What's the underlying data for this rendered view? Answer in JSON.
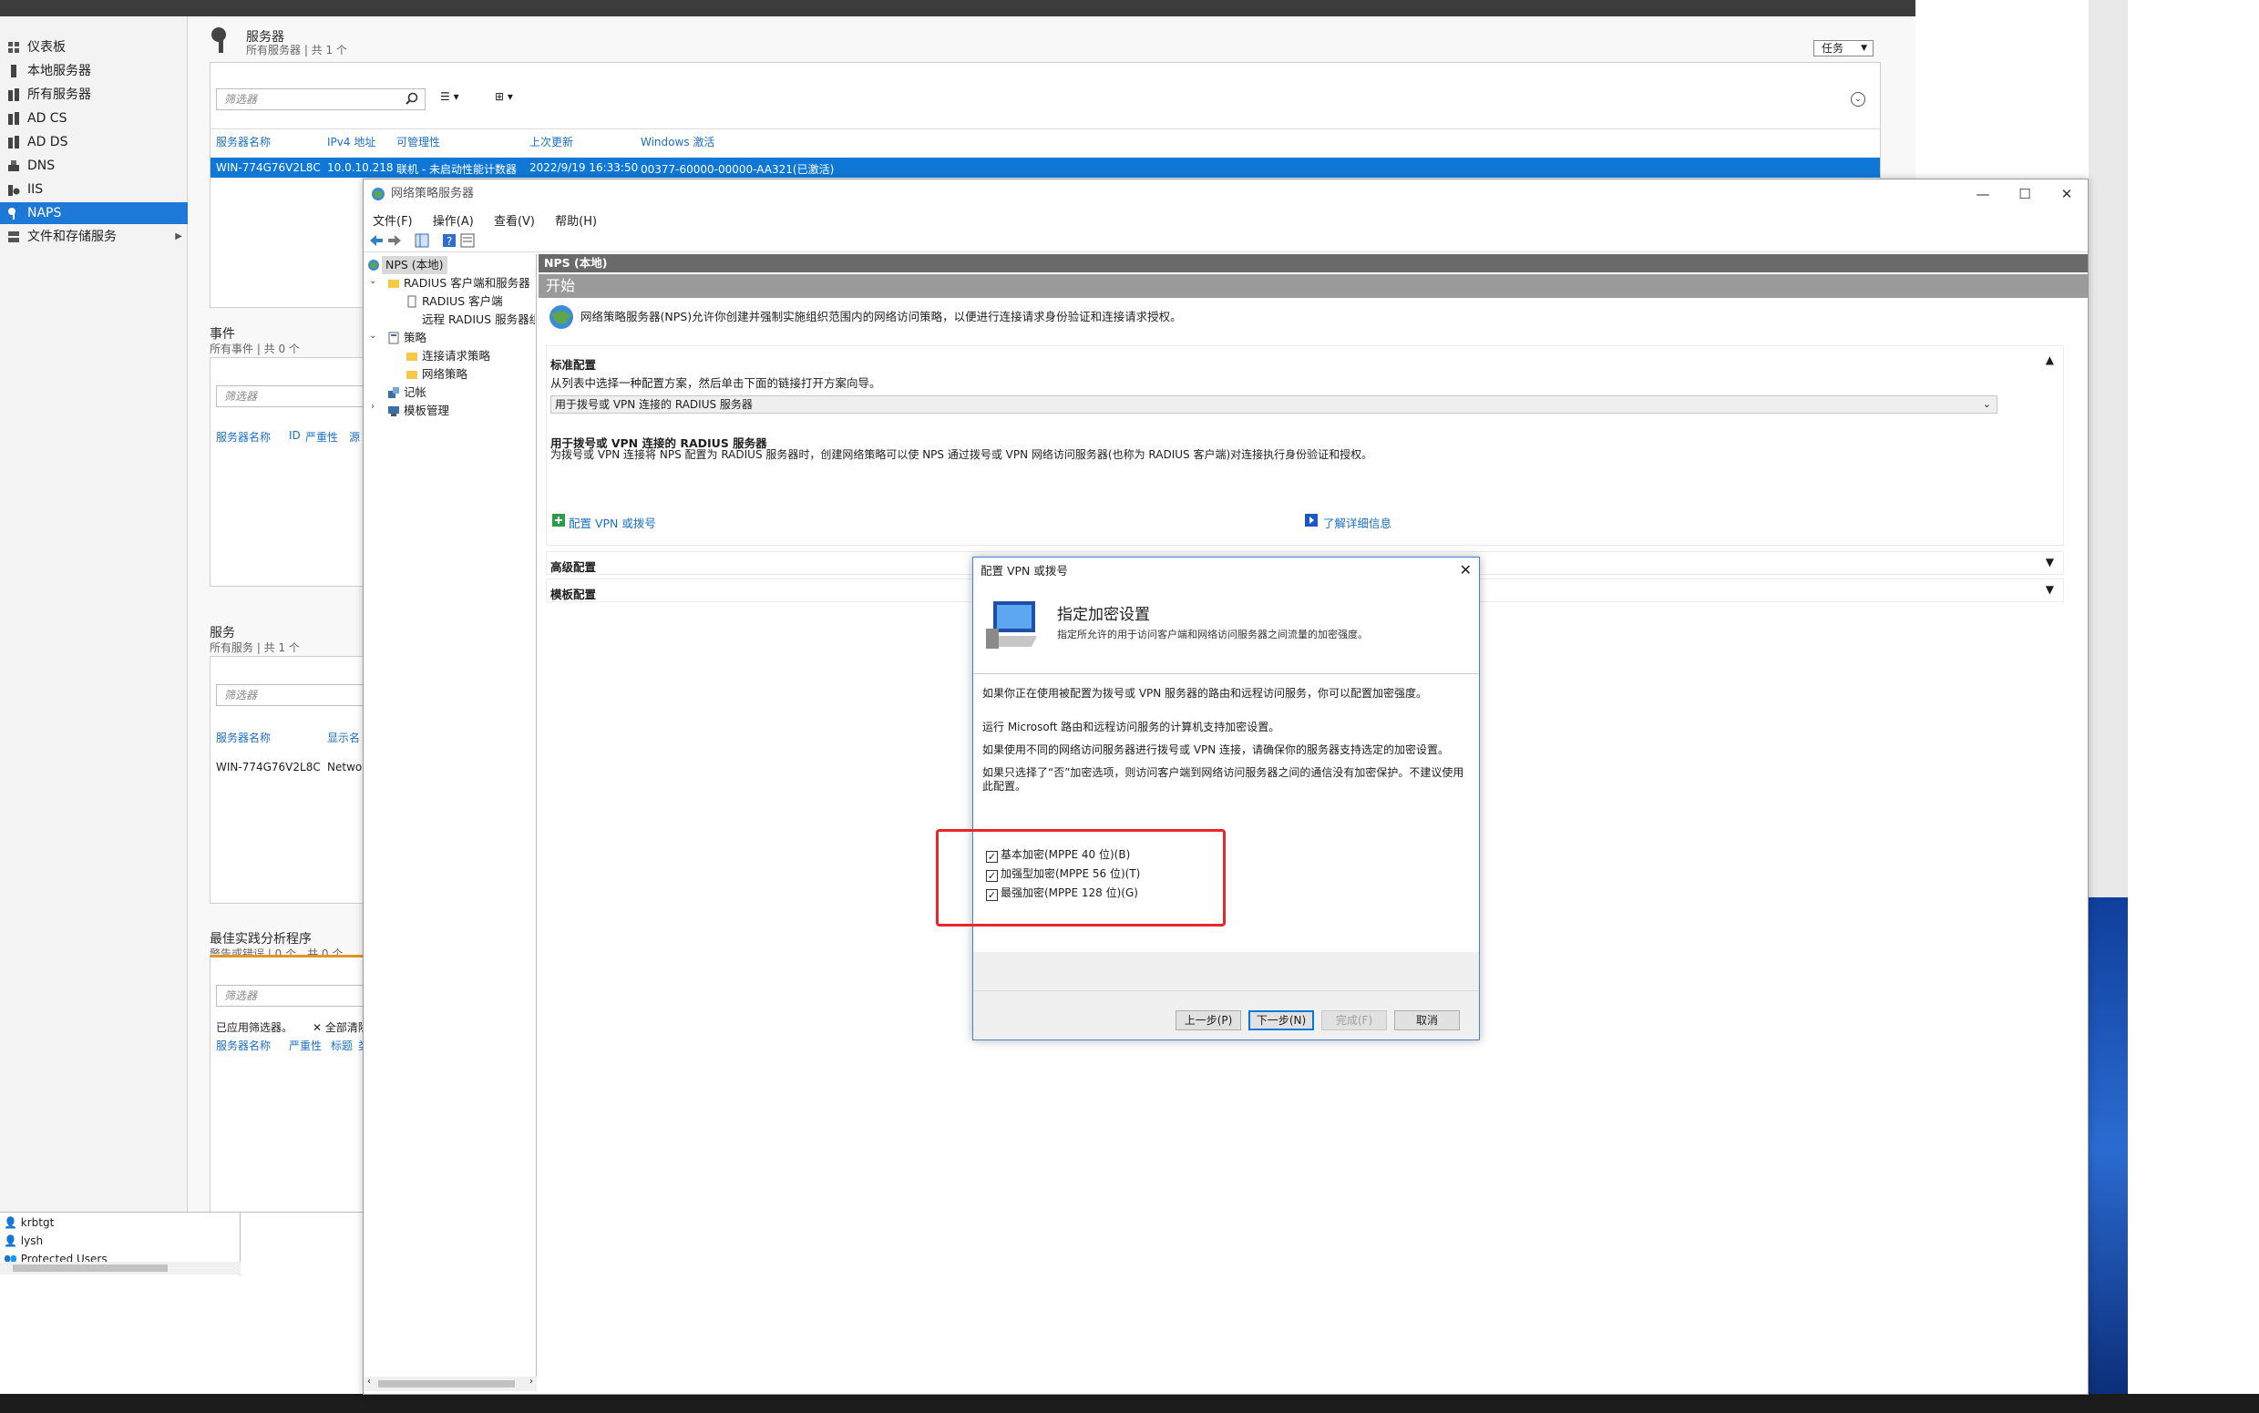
{
  "nav": {
    "items": [
      {
        "label": "仪表板",
        "icon": "dashboard-icon"
      },
      {
        "label": "本地服务器",
        "icon": "server-icon"
      },
      {
        "label": "所有服务器",
        "icon": "servers-icon"
      },
      {
        "label": "AD CS",
        "icon": "adcs-icon"
      },
      {
        "label": "AD DS",
        "icon": "adds-icon"
      },
      {
        "label": "DNS",
        "icon": "dns-icon"
      },
      {
        "label": "IIS",
        "icon": "iis-icon"
      },
      {
        "label": "NAPS",
        "icon": "naps-icon"
      },
      {
        "label": "文件和存储服务",
        "icon": "storage-icon"
      }
    ]
  },
  "servers": {
    "title": "服务器",
    "subtitle": "所有服务器 | 共 1 个",
    "filter_placeholder": "筛选器",
    "tasks_label": "任务",
    "columns": [
      "服务器名称",
      "IPv4 地址",
      "可管理性",
      "上次更新",
      "Windows 激活"
    ],
    "row": [
      "WIN-774G76V2L8C",
      "10.0.10.218",
      "联机 - 未启动性能计数器",
      "2022/9/19 16:33:50",
      "00377-60000-00000-AA321(已激活)"
    ]
  },
  "events": {
    "title": "事件",
    "subtitle": "所有事件 | 共 0 个",
    "filter_placeholder": "筛选器",
    "columns": [
      "服务器名称",
      "ID",
      "严重性",
      "源"
    ]
  },
  "services": {
    "title": "服务",
    "subtitle": "所有服务 | 共 1 个",
    "filter_placeholder": "筛选器",
    "columns": [
      "服务器名称",
      "显示名"
    ],
    "row": [
      "WIN-774G76V2L8C",
      "Netwo"
    ]
  },
  "bpa": {
    "title": "最佳实践分析程序",
    "subtitle": "警告或错误 | 0 个，共 0 个",
    "filter_placeholder": "筛选器",
    "applied": "已应用筛选器。",
    "clear_all": "全部清除",
    "columns": [
      "服务器名称",
      "严重性",
      "标题",
      "类"
    ]
  },
  "bottom_list": {
    "items": [
      "krbtgt",
      "lysh",
      "Protected Users"
    ]
  },
  "nps": {
    "window_title": "网络策略服务器",
    "menu": [
      "文件(F)",
      "操作(A)",
      "查看(V)",
      "帮助(H)"
    ],
    "tree": {
      "root": "NPS (本地)",
      "radius": "RADIUS 客户端和服务器",
      "radius_clients": "RADIUS 客户端",
      "remote_radius": "远程 RADIUS 服务器组",
      "policies": "策略",
      "conn_policies": "连接请求策略",
      "net_policies": "网络策略",
      "accounting": "记帐",
      "templates": "模板管理"
    },
    "header_dark": "NPS (本地)",
    "header_mid": "开始",
    "intro": "网络策略服务器(NPS)允许你创建并强制实施组织范围内的网络访问策略，以便进行连接请求身份验证和连接请求授权。",
    "standard": {
      "title": "标准配置",
      "desc": "从列表中选择一种配置方案，然后单击下面的链接打开方案向导。",
      "select_value": "用于拨号或 VPN 连接的 RADIUS 服务器",
      "sub_title": "用于拨号或 VPN 连接的 RADIUS 服务器",
      "sub_desc": "为拨号或 VPN 连接将 NPS 配置为 RADIUS 服务器时，创建网络策略可以使 NPS 通过拨号或 VPN 网络访问服务器(也称为 RADIUS 客户端)对连接执行身份验证和授权。",
      "config_link": "配置 VPN 或拨号",
      "learn_link": "了解详细信息"
    },
    "advanced": "高级配置",
    "template": "模板配置"
  },
  "dialog": {
    "title": "配置 VPN 或拨号",
    "heading": "指定加密设置",
    "subheading": "指定所允许的用于访问客户端和网络访问服务器之间流量的加密强度。",
    "p1": "如果你正在使用被配置为拨号或 VPN 服务器的路由和远程访问服务，你可以配置加密强度。",
    "p2": "运行 Microsoft 路由和远程访问服务的计算机支持加密设置。",
    "p3": "如果使用不同的网络访问服务器进行拨号或 VPN 连接，请确保你的服务器支持选定的加密设置。",
    "p4": "如果只选择了“否”加密选项，则访问客户端到网络访问服务器之间的通信没有加密保护。不建议使用此配置。",
    "checks": [
      {
        "label": "基本加密(MPPE 40 位)(B)",
        "checked": true
      },
      {
        "label": "加强型加密(MPPE 56 位)(T)",
        "checked": true
      },
      {
        "label": "最强加密(MPPE 128 位)(G)",
        "checked": true
      }
    ],
    "buttons": {
      "back": "上一步(P)",
      "next": "下一步(N)",
      "finish": "完成(F)",
      "cancel": "取消"
    }
  },
  "colors": {
    "accent": "#1e78d7",
    "highlight": "#e8262b",
    "selection": "#0f78d7"
  }
}
